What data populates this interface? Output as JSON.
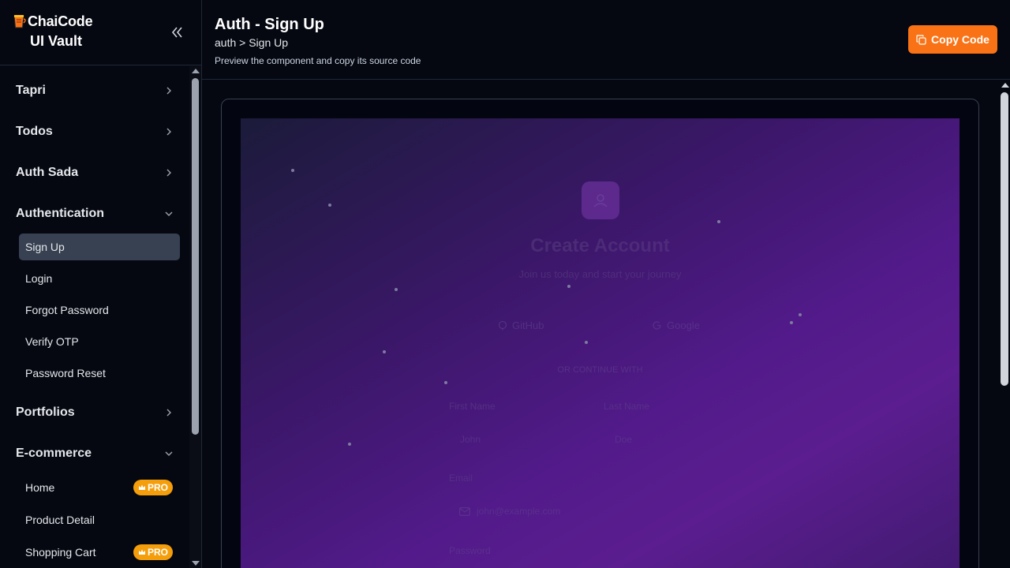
{
  "brand": {
    "name": "ChaiCode",
    "subtitle": "UI Vault"
  },
  "sidebar": {
    "groups": [
      {
        "label": "Tapri",
        "expanded": false
      },
      {
        "label": "Todos",
        "expanded": false
      },
      {
        "label": "Auth Sada",
        "expanded": false
      },
      {
        "label": "Authentication",
        "expanded": true
      },
      {
        "label": "Portfolios",
        "expanded": false
      },
      {
        "label": "E-commerce",
        "expanded": true
      }
    ],
    "auth_items": [
      {
        "label": "Sign Up",
        "active": true
      },
      {
        "label": "Login"
      },
      {
        "label": "Forgot Password"
      },
      {
        "label": "Verify OTP"
      },
      {
        "label": "Password Reset"
      }
    ],
    "ecommerce_items": [
      {
        "label": "Home",
        "badge": "PRO"
      },
      {
        "label": "Product Detail"
      },
      {
        "label": "Shopping Cart",
        "badge": "PRO"
      }
    ]
  },
  "header": {
    "title": "Auth - Sign Up",
    "breadcrumb": "auth > Sign Up",
    "subtitle": "Preview the component and copy its source code",
    "copy_label": "Copy Code"
  },
  "preview": {
    "title": "Create Account",
    "subtitle": "Join us today and start your journey",
    "github_label": "GitHub",
    "google_label": "Google",
    "divider": "OR CONTINUE WITH",
    "first_name_label": "First Name",
    "last_name_label": "Last Name",
    "first_name_placeholder": "John",
    "last_name_placeholder": "Doe",
    "email_label": "Email",
    "email_placeholder": "john@example.com",
    "password_label": "Password"
  },
  "colors": {
    "accent": "#f97316",
    "pro_badge": "#f59e0b",
    "active_item": "#374151"
  }
}
